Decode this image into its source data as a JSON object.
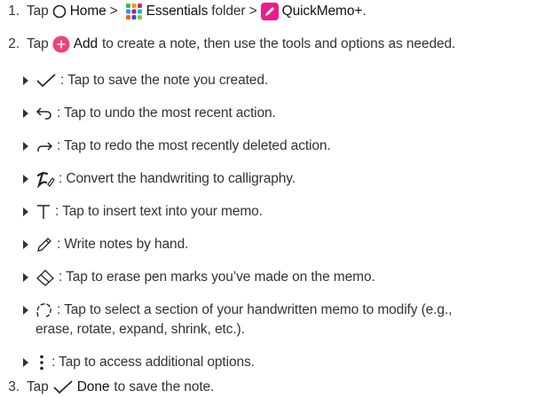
{
  "steps": {
    "s1": {
      "num": "1.",
      "tap": "Tap",
      "home": "Home",
      "sep1": ">",
      "essentials": "Essentials",
      "folder": "folder >",
      "quickmemo": "QuickMemo+",
      "end": "."
    },
    "s2": {
      "num": "2.",
      "tap": "Tap",
      "add": "Add",
      "rest": "to create a note, then use the tools and options as needed."
    },
    "s3": {
      "num": "3.",
      "tap": "Tap",
      "done": "Done",
      "rest": "to save the note."
    }
  },
  "bullets": [
    {
      "icon": "checkmark-icon",
      "text": ": Tap to save the note you created."
    },
    {
      "icon": "undo-icon",
      "text": ": Tap to undo the most recent action."
    },
    {
      "icon": "redo-icon",
      "text": ": Tap to redo the most recently deleted action."
    },
    {
      "icon": "calligraphy-icon",
      "text": ": Convert the handwriting to calligraphy."
    },
    {
      "icon": "text-icon",
      "text": ": Tap to insert text into your memo."
    },
    {
      "icon": "pen-icon",
      "text": ": Write notes by hand."
    },
    {
      "icon": "eraser-icon",
      "text": ": Tap to erase pen marks you’ve made on the memo."
    },
    {
      "icon": "lasso-icon",
      "text": ": Tap to select a section of your handwritten memo to modify (e.g.,",
      "cont": "erase, rotate, expand, shrink, etc.)."
    },
    {
      "icon": "more-options-icon",
      "text": ": Tap to access additional options."
    }
  ],
  "colors": {
    "add_button": "#f0417b",
    "quickmemo_icon": "#e91e8c",
    "text": "#333333"
  }
}
